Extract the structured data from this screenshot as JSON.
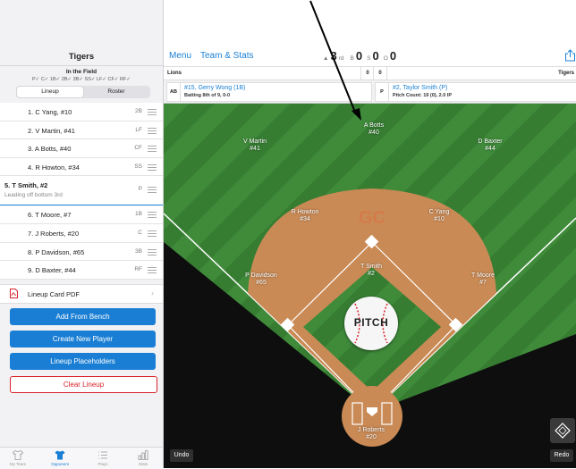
{
  "left_panel": {
    "team_name": "Tigers",
    "in_field_title": "In the Field",
    "position_checklist": "P✓  C✓  1B✓  2B✓  3B✓  SS✓  LF✓  CF✓  RF✓",
    "segments": [
      "Lineup",
      "Roster"
    ],
    "lineup": [
      {
        "name": "1. C Yang, #10",
        "pos": "2B"
      },
      {
        "name": "2. V Martin, #41",
        "pos": "LF"
      },
      {
        "name": "3. A Botts, #40",
        "pos": "CF"
      },
      {
        "name": "4. R Howton, #34",
        "pos": "SS"
      },
      {
        "name": "5. T Smith, #2",
        "pos": "P",
        "sub": "Leading off bottom 3rd"
      },
      {
        "name": "6. T Moore, #7",
        "pos": "1B"
      },
      {
        "name": "7. J Roberts, #20",
        "pos": "C"
      },
      {
        "name": "8. P Davidson, #65",
        "pos": "3B"
      },
      {
        "name": "9. D Baxter, #44",
        "pos": "RF"
      }
    ],
    "pdf_label": "Lineup Card PDF",
    "pdf_chevron": "›",
    "buttons": {
      "add_from_bench": "Add From Bench",
      "create_new_player": "Create New Player",
      "lineup_placeholders": "Lineup Placeholders",
      "clear_lineup": "Clear Lineup"
    },
    "tabs": [
      {
        "label": "My Team",
        "icon": "shirt-icon"
      },
      {
        "label": "Opponent",
        "icon": "shirt-icon"
      },
      {
        "label": "Plays",
        "icon": "list-icon"
      },
      {
        "label": "Stats",
        "icon": "bar-chart-icon"
      }
    ]
  },
  "top_bar": {
    "menu": "Menu",
    "team_stats": "Team & Stats",
    "inning_arrow": "▲",
    "inning": "3",
    "inning_suffix": "rd",
    "balls_label": "B",
    "balls": "0",
    "strikes_label": "S",
    "strikes": "0",
    "outs_label": "O",
    "outs": "0"
  },
  "score": {
    "away_team": "Lions",
    "away_score": "0",
    "home_score": "0",
    "home_team": "Tigers"
  },
  "batter": {
    "tag": "AB",
    "name": "#15, Gerry Wong (1B)",
    "info": "Batting 8th of 9, 0-0"
  },
  "pitcher": {
    "tag": "P",
    "name": "#2, Taylor Smith (P)",
    "info": "Pitch Count: 19 (0), 2.0 IP"
  },
  "field": {
    "logo": "GC",
    "pitch_button": "PITCH",
    "undo": "Undo",
    "redo": "Redo",
    "players": {
      "cf": {
        "name": "A Botts",
        "num": "#40"
      },
      "lf": {
        "name": "V Martin",
        "num": "#41"
      },
      "rf": {
        "name": "D Baxter",
        "num": "#44"
      },
      "ss": {
        "name": "R Howton",
        "num": "#34"
      },
      "second": {
        "name": "C Yang",
        "num": "#10"
      },
      "p": {
        "name": "T Smith",
        "num": "#2"
      },
      "third": {
        "name": "P Davidson",
        "num": "#65"
      },
      "first": {
        "name": "T Moore",
        "num": "#7"
      },
      "c": {
        "name": "J Roberts",
        "num": "#20"
      }
    }
  },
  "colors": {
    "accent": "#1a7fd4",
    "danger": "#d9222a",
    "grass": "#3f8b3a",
    "dirt": "#c98a55"
  }
}
